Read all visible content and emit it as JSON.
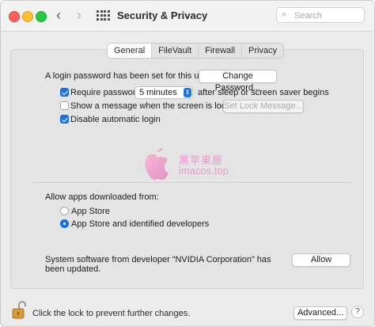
{
  "window": {
    "title": "Security & Privacy"
  },
  "toolbar": {
    "search_placeholder": "Search",
    "back_icon": "chevron-left-icon",
    "forward_icon": "chevron-right-icon",
    "grid_icon": "app-grid-icon"
  },
  "tabs": [
    {
      "label": "General",
      "selected": true
    },
    {
      "label": "FileVault",
      "selected": false
    },
    {
      "label": "Firewall",
      "selected": false
    },
    {
      "label": "Privacy",
      "selected": false
    }
  ],
  "general": {
    "login_password_text": "A login password has been set for this user",
    "change_password_button": "Change Password...",
    "require_password": {
      "label": "Require password",
      "checked": true,
      "select_value": "5 minutes",
      "suffix": "after sleep or screen saver begins"
    },
    "show_message": {
      "label": "Show a message when the screen is locked",
      "checked": false,
      "button": "Set Lock Message..."
    },
    "disable_auto_login": {
      "label": "Disable automatic login",
      "checked": true
    }
  },
  "watermark": {
    "cn": "黑苹果屋",
    "url": "imacos.top"
  },
  "downloads": {
    "heading": "Allow apps downloaded from:",
    "options": [
      {
        "label": "App Store",
        "selected": false
      },
      {
        "label": "App Store and identified developers",
        "selected": true
      }
    ]
  },
  "system_software": {
    "line1": "System software from developer “NVIDIA Corporation” has",
    "line2": "been updated.",
    "allow_button": "Allow"
  },
  "footer": {
    "lock_text": "Click the lock to prevent further changes.",
    "advanced_button": "Advanced...",
    "help_button": "?",
    "lock_icon": "lock-open-icon"
  },
  "colors": {
    "accent": "#1a73e8",
    "close": "#fe5f57",
    "minimize": "#febc2e",
    "zoom": "#28c840"
  }
}
